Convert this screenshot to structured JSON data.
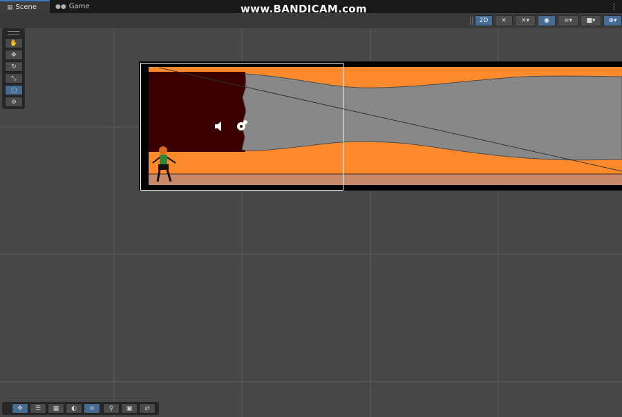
{
  "tabs": [
    {
      "label": "Scene",
      "icon": "grid-icon",
      "active": true
    },
    {
      "label": "Game",
      "icon": "gamepad-icon",
      "active": false
    }
  ],
  "watermark": "www.BANDICAM.com",
  "overlay": {
    "mode2d_label": "2D",
    "buttons": [
      "lighting-toggle-icon",
      "audio-toggle-icon",
      "visibility-icon",
      "layers-icon",
      "camera-icon",
      "gizmos-icon"
    ]
  },
  "tools": [
    "hand-tool",
    "move-tool",
    "rotate-tool",
    "scale-tool",
    "rect-tool",
    "transform-tool"
  ],
  "active_tool": "rect-tool",
  "bottom_tools": [
    "move-tool",
    "snap-tool",
    "grid-tool",
    "orbit-tool",
    "layers-tool",
    "search-tool",
    "camera-tool",
    "shuffle-tool"
  ],
  "colors": {
    "accent": "#466c94",
    "lava": "#ff8a2b",
    "rock": "#888888",
    "dark_wall": "#3a0000",
    "floor": "#c8886a",
    "frame": "#000000"
  }
}
